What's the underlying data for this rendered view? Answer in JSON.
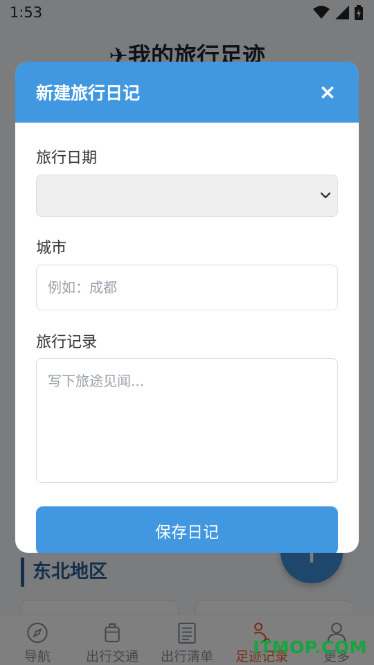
{
  "status_bar": {
    "time": "1:53",
    "icons": [
      "wifi-icon",
      "signal-icon",
      "battery-icon"
    ]
  },
  "app": {
    "title": "✈我的旅行足迹"
  },
  "section": {
    "heading": "东北地区"
  },
  "fab": {
    "icon": "plus-icon"
  },
  "bottom_nav": {
    "items": [
      {
        "label": "导航",
        "icon": "compass-icon",
        "active": false
      },
      {
        "label": "出行交通",
        "icon": "luggage-icon",
        "active": false
      },
      {
        "label": "出行清单",
        "icon": "checklist-icon",
        "active": false
      },
      {
        "label": "足迹记录",
        "icon": "footprint-icon",
        "active": true
      },
      {
        "label": "更多",
        "icon": "user-icon",
        "active": false
      }
    ]
  },
  "modal": {
    "title": "新建旅行日记",
    "close_label": "×",
    "date_label": "旅行日期",
    "date_value": "",
    "city_label": "城市",
    "city_placeholder": "例如：成都",
    "record_label": "旅行记录",
    "record_placeholder": "写下旅途见闻...",
    "save_label": "保存日记"
  },
  "watermark": {
    "text": "ITMOP.COM"
  },
  "colors": {
    "primary": "#4298e0",
    "active_nav": "#e8602c",
    "section_accent": "#2a5d95",
    "watermark": "#16a53c"
  }
}
